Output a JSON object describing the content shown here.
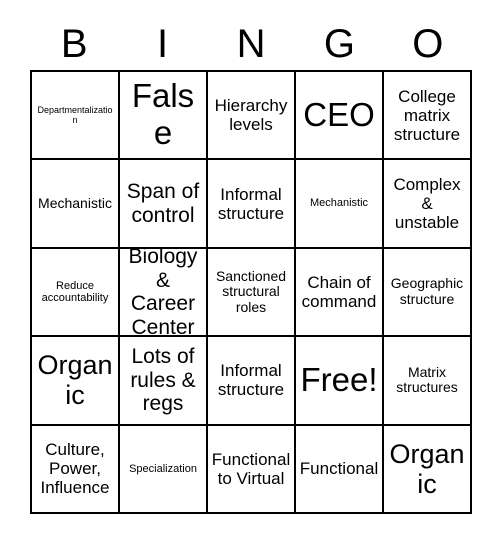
{
  "card": {
    "header_letters": [
      "B",
      "I",
      "N",
      "G",
      "O"
    ],
    "rows": [
      [
        {
          "text": "Departmentalization",
          "size": "xxs"
        },
        {
          "text": "False",
          "size": "xxl"
        },
        {
          "text": "Hierarchy levels",
          "size": "md"
        },
        {
          "text": "CEO",
          "size": "xxl"
        },
        {
          "text": "College matrix structure",
          "size": "md"
        }
      ],
      [
        {
          "text": "Mechanistic",
          "size": "sm"
        },
        {
          "text": "Span of control",
          "size": "lg"
        },
        {
          "text": "Informal structure",
          "size": "md"
        },
        {
          "text": "Mechanistic",
          "size": "xs"
        },
        {
          "text": "Complex & unstable",
          "size": "md"
        }
      ],
      [
        {
          "text": "Reduce accountability",
          "size": "xs"
        },
        {
          "text": "Biology & Career Center",
          "size": "lg"
        },
        {
          "text": "Sanctioned structural roles",
          "size": "sm"
        },
        {
          "text": "Chain of command",
          "size": "md"
        },
        {
          "text": "Geographic structure",
          "size": "sm"
        }
      ],
      [
        {
          "text": "Organic",
          "size": "xl"
        },
        {
          "text": "Lots of rules & regs",
          "size": "lg"
        },
        {
          "text": "Informal structure",
          "size": "md"
        },
        {
          "text": "Free!",
          "size": "xxl"
        },
        {
          "text": "Matrix structures",
          "size": "sm"
        }
      ],
      [
        {
          "text": "Culture, Power, Influence",
          "size": "md"
        },
        {
          "text": "Specialization",
          "size": "xs"
        },
        {
          "text": "Functional to Virtual",
          "size": "md"
        },
        {
          "text": "Functional",
          "size": "md"
        },
        {
          "text": "Organic",
          "size": "xl"
        }
      ]
    ]
  }
}
